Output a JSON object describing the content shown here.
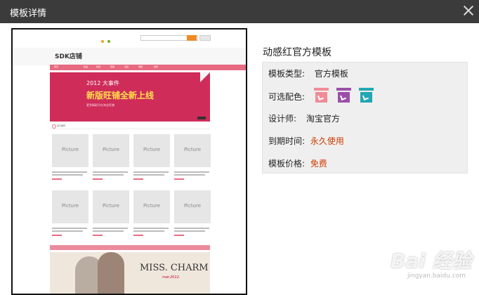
{
  "dialog": {
    "title": "模板详情"
  },
  "preview": {
    "shop_name": "SDK店铺",
    "nav_items": [
      "首页",
      "新品",
      "热卖",
      "促销",
      "活动",
      "收藏",
      "会员"
    ],
    "banner": {
      "line1": "2012 大事件",
      "line2": "新版旺铺全新上线",
      "line3": "更多精彩尽在淘宝旺铺"
    },
    "section_label": "宝贝推荐",
    "product_placeholder": "Picture",
    "model_text": "MISS. CHARM",
    "model_sub": "mar.2012."
  },
  "info": {
    "template_name": "动感红官方模板",
    "type_label": "模板类型:",
    "type_value": "官方模板",
    "colors_label": "可选配色:",
    "colors": [
      "#f08c96",
      "#9b4fa8",
      "#22a6b3"
    ],
    "designer_label": "设计师:",
    "designer_value": "淘宝官方",
    "expiry_label": "到期时间:",
    "expiry_value": "永久使用",
    "price_label": "模板价格:",
    "price_value": "免费"
  },
  "watermark": {
    "main": "Bai 经验",
    "sub": "jingyan.baidu.com"
  }
}
